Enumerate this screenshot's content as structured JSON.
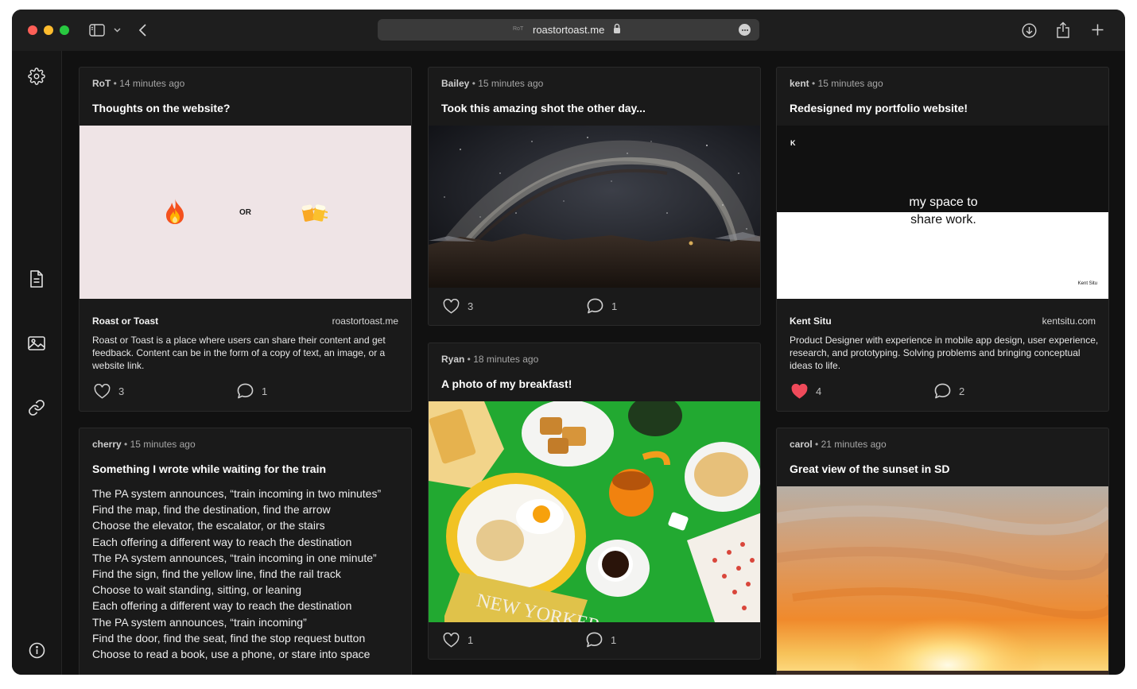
{
  "browser": {
    "url": "roastortoast.me",
    "favicon_text": "RoT",
    "buttons": [
      "sidebar-toggle",
      "back",
      "downloads",
      "share",
      "new-tab"
    ]
  },
  "colors": {
    "background": "#111111",
    "card": "#1a1a1a",
    "like_active": "#ef4a5a",
    "traffic_red": "#fe5f57",
    "traffic_yellow": "#febc2e",
    "traffic_green": "#28c840"
  },
  "sidebar": {
    "icons": [
      "gear-icon",
      "document-icon",
      "image-icon",
      "link-icon",
      "info-icon"
    ]
  },
  "posts": [
    {
      "author": "RoT",
      "time": "14 minutes ago",
      "title": "Thoughts on the website?",
      "type": "link",
      "preview_or": "OR",
      "link_title": "Roast or Toast",
      "link_domain": "roastortoast.me",
      "link_desc": "Roast or Toast is a place where users can share their content and get feedback. Content can be in the form of a copy of text, an image, or a website link.",
      "likes": "3",
      "comments": "1",
      "liked": false
    },
    {
      "author": "Bailey",
      "time": "15 minutes ago",
      "title": "Took this amazing shot the other day...",
      "type": "image",
      "likes": "3",
      "comments": "1",
      "liked": false
    },
    {
      "author": "kent",
      "time": "15 minutes ago",
      "title": "Redesigned my portfolio website!",
      "type": "link",
      "preview_logo": "K",
      "preview_text_1": "my space to",
      "preview_text_2": "share work.",
      "preview_footer": "Kent Situ",
      "link_title": "Kent Situ",
      "link_domain": "kentsitu.com",
      "link_desc": "Product Designer with experience in mobile app design, user experience, research, and prototyping. Solving problems and bringing conceptual ideas to life.",
      "likes": "4",
      "comments": "2",
      "liked": true
    },
    {
      "author": "Ryan",
      "time": "18 minutes ago",
      "title": "A photo of my breakfast!",
      "type": "image",
      "magazine_text": "NEW YORKER",
      "likes": "1",
      "comments": "1",
      "liked": false
    },
    {
      "author": "cherry",
      "time": "15 minutes ago",
      "title": "Something I wrote while waiting for the train",
      "type": "text",
      "body": "The PA system announces, “train incoming in two minutes”\nFind the map, find the destination, find the arrow\nChoose the elevator, the escalator, or the stairs\nEach offering a different way to reach the destination\nThe PA system announces, “train incoming in one minute”\nFind the sign, find the yellow line, find the rail track\nChoose to wait standing, sitting, or leaning\nEach offering a different way to reach the destination\nThe PA system announces, “train incoming”\nFind the door, find the seat, find the stop request button\nChoose to read a book, use a phone, or stare into space"
    },
    {
      "author": "carol",
      "time": "21 minutes ago",
      "title": "Great view of the sunset in SD",
      "type": "image"
    }
  ]
}
